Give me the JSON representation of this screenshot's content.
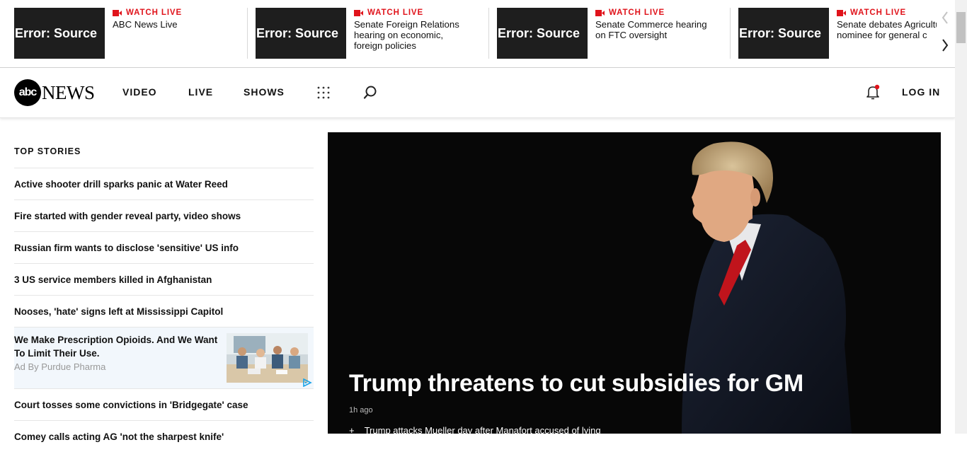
{
  "ticker": {
    "items": [
      {
        "thumb_text": "Error: Source",
        "badge": "WATCH LIVE",
        "title": "ABC News Live"
      },
      {
        "thumb_text": "Error: Source",
        "badge": "WATCH LIVE",
        "title": "Senate Foreign Relations hearing on economic, foreign policies"
      },
      {
        "thumb_text": "Error: Source",
        "badge": "WATCH LIVE",
        "title": "Senate Commerce hearing on FTC oversight"
      },
      {
        "thumb_text": "Error: Source",
        "badge": "WATCH LIVE",
        "title": "Senate debates Agriculture nominee for general c"
      }
    ]
  },
  "header": {
    "logo_abc": "abc",
    "logo_news": "NEWS",
    "nav": [
      "VIDEO",
      "LIVE",
      "SHOWS"
    ],
    "login": "LOG IN"
  },
  "top_stories": {
    "heading": "TOP STORIES",
    "items": [
      "Active shooter drill sparks panic at Water Reed",
      "Fire started with gender reveal party, video shows",
      "Russian firm wants to disclose 'sensitive' US info",
      "3 US service members killed in Afghanistan",
      "Nooses, 'hate' signs left at Mississippi Capitol"
    ],
    "ad": {
      "title": "We Make Prescription Opioids. And We Want To Limit Their Use.",
      "sponsor": "Ad By Purdue Pharma"
    },
    "more_items": [
      "Court tosses some convictions in 'Bridgegate' case",
      "Comey calls acting AG 'not the sharpest knife'"
    ]
  },
  "hero": {
    "headline": "Trump threatens to cut subsidies for GM",
    "time": "1h ago",
    "related_plus": "+",
    "related": "Trump attacks Mueller day after Manafort accused of lying"
  },
  "colors": {
    "live_red": "#e0131b",
    "hero_bg": "#070707",
    "ad_bg": "#f2f7fc"
  }
}
